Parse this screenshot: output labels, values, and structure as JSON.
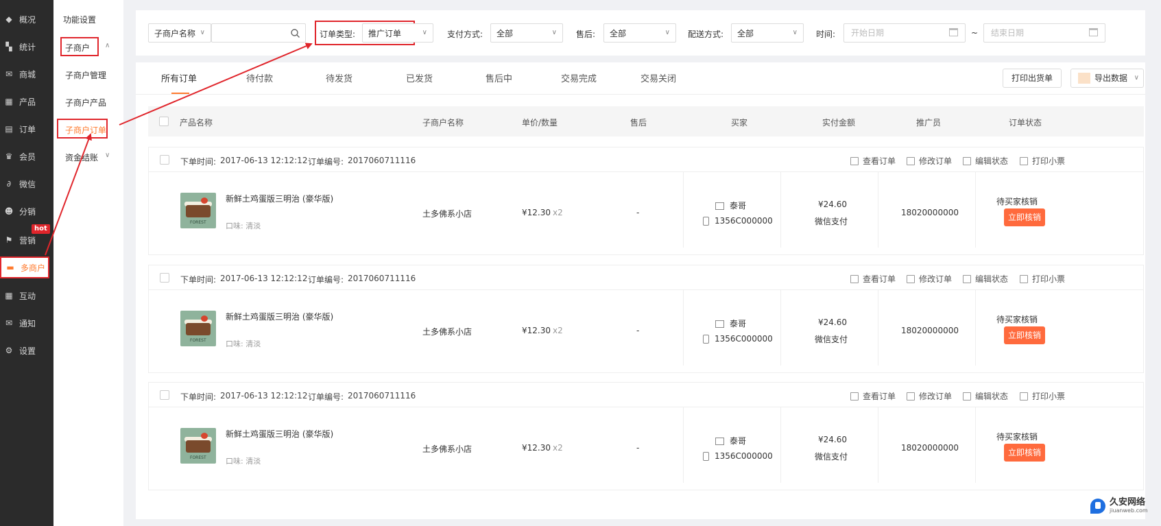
{
  "nav": {
    "items": [
      {
        "label": "概况",
        "icon": "layers-icon"
      },
      {
        "label": "统计",
        "icon": "chart-icon"
      },
      {
        "label": "商城",
        "icon": "mail-icon"
      },
      {
        "label": "产品",
        "icon": "grid-icon"
      },
      {
        "label": "订单",
        "icon": "clipboard-icon"
      },
      {
        "label": "会员",
        "icon": "crown-icon"
      },
      {
        "label": "微信",
        "icon": "link-icon"
      },
      {
        "label": "分销",
        "icon": "people-icon"
      },
      {
        "label": "营销",
        "icon": "flag-icon"
      },
      {
        "label": "多商户",
        "icon": "store-icon"
      },
      {
        "label": "互动",
        "icon": "grid-icon"
      },
      {
        "label": "通知",
        "icon": "mail-icon"
      },
      {
        "label": "设置",
        "icon": "gear-icon"
      }
    ],
    "hot_badge": "hot",
    "active_index": 9
  },
  "subnav": {
    "function_settings": "功能设置",
    "sub_merchant": "子商户",
    "sub_merchant_manage": "子商户管理",
    "sub_merchant_products": "子商户产品",
    "sub_merchant_orders": "子商户订单",
    "settlement": "资金结账"
  },
  "filter": {
    "merchant_select": "子商户名称",
    "search_value": "",
    "order_type_label": "订单类型:",
    "order_type_value": "推广订单",
    "pay_label": "支付方式:",
    "pay_value": "全部",
    "after_sale_label": "售后:",
    "after_sale_value": "全部",
    "delivery_label": "配送方式:",
    "delivery_value": "全部",
    "time_label": "时间:",
    "start_placeholder": "开始日期",
    "range_sep": "~",
    "end_placeholder": "结束日期"
  },
  "tabs": [
    "所有订单",
    "待付款",
    "待发货",
    "已发货",
    "售后中",
    "交易完成",
    "交易关闭"
  ],
  "toolbar": {
    "print_shipping": "打印出货单",
    "export": "导出数据"
  },
  "columns": [
    "产品名称",
    "子商户名称",
    "单价/数量",
    "售后",
    "买家",
    "实付金额",
    "推广员",
    "订单状态"
  ],
  "order_labels": {
    "time_prefix": "下单时间:",
    "no_prefix": "订单编号:",
    "view": "查看订单",
    "edit": "修改订单",
    "edit_status": "编辑状态",
    "print_receipt": "打印小票",
    "verify_button": "立即核销"
  },
  "orders": [
    {
      "time": "2017-06-13 12:12:12",
      "number": "2017060711116",
      "product": "新鲜土鸡蛋版三明治 (豪华版)",
      "flavor": "口味: 清淡",
      "thumb_brand": "FOREST",
      "merchant": "土多佛系小店",
      "price": "¥12.30",
      "qty": "x2",
      "after_sale": "-",
      "buyer": "泰哥",
      "phone": "1356C000000",
      "amount": "¥24.60",
      "pay": "微信支付",
      "promoter": "18020000000",
      "status": "待买家核销"
    },
    {
      "time": "2017-06-13 12:12:12",
      "number": "2017060711116",
      "product": "新鲜土鸡蛋版三明治 (豪华版)",
      "flavor": "口味: 清淡",
      "thumb_brand": "FOREST",
      "merchant": "土多佛系小店",
      "price": "¥12.30",
      "qty": "x2",
      "after_sale": "-",
      "buyer": "泰哥",
      "phone": "1356C000000",
      "amount": "¥24.60",
      "pay": "微信支付",
      "promoter": "18020000000",
      "status": "待买家核销"
    },
    {
      "time": "2017-06-13 12:12:12",
      "number": "2017060711116",
      "product": "新鲜土鸡蛋版三明治 (豪华版)",
      "flavor": "口味: 清淡",
      "thumb_brand": "FOREST",
      "merchant": "土多佛系小店",
      "price": "¥12.30",
      "qty": "x2",
      "after_sale": "-",
      "buyer": "泰哥",
      "phone": "1356C000000",
      "amount": "¥24.60",
      "pay": "微信支付",
      "promoter": "18020000000",
      "status": "待买家核销"
    }
  ],
  "watermark": {
    "title": "久安网络",
    "sub": "jiuanweb.com"
  },
  "colors": {
    "accent": "#ff7a2e",
    "highlight": "#e0252b",
    "nav_bg": "#2b2b2b"
  }
}
